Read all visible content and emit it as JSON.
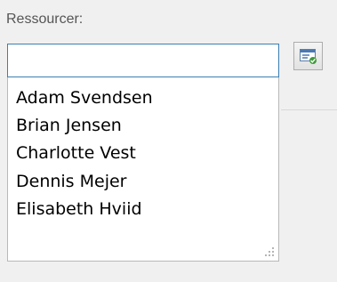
{
  "resource_field": {
    "label": "Ressourcer:",
    "value": "",
    "picker_icon": "resource-picker-icon",
    "options": [
      {
        "label": "Adam Svendsen"
      },
      {
        "label": "Brian Jensen"
      },
      {
        "label": "Charlotte Vest"
      },
      {
        "label": "Dennis Mejer"
      },
      {
        "label": "Elisabeth Hviid"
      }
    ]
  },
  "colors": {
    "focus_border": "#3c7fb1",
    "background": "#f0f0f0"
  }
}
